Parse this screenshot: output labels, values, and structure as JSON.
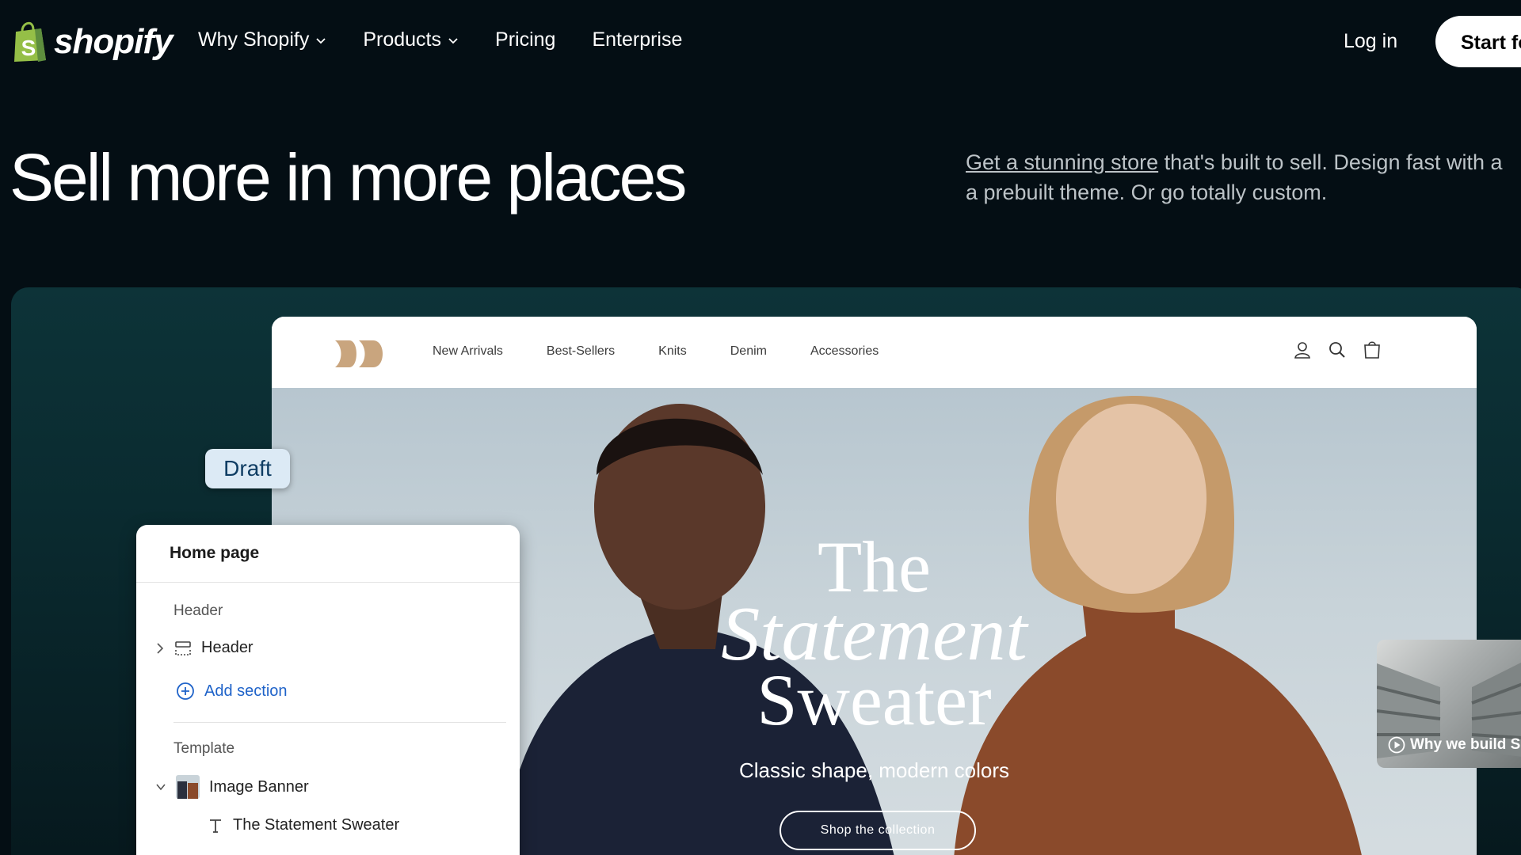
{
  "nav": {
    "logo_text": "shopify",
    "links": [
      "Why Shopify",
      "Products",
      "Pricing",
      "Enterprise"
    ],
    "login": "Log in",
    "cta": "Start fo"
  },
  "hero": {
    "title": "Sell more in more places",
    "link_text": "Get a stunning store",
    "copy_line1_rest": " that's built to sell. Design fast with a",
    "copy_line2": "a prebuilt theme. Or go totally custom."
  },
  "store": {
    "links": [
      "New Arrivals",
      "Best-Sellers",
      "Knits",
      "Denim",
      "Accessories"
    ],
    "icons": [
      "account-icon",
      "search-icon",
      "cart-icon"
    ],
    "banner": {
      "title_line1": "The",
      "title_line2": "Statement",
      "title_line3": "Sweater",
      "subtitle": "Classic shape, modern colors",
      "button": "Shop the collection"
    }
  },
  "badge": "Draft",
  "editor": {
    "title": "Home page",
    "group_header": "Header",
    "header_item": "Header",
    "add_section": "Add section",
    "group_template": "Template",
    "image_banner": "Image Banner",
    "sub_item": "The Statement Sweater"
  },
  "video": {
    "label": "Why we build S"
  },
  "colors": {
    "page_bg": "#040e14",
    "panel_teal": "#0d3338",
    "brand_green": "#95bf47",
    "link_blue": "#1f63c9",
    "store_logo": "#c9a57e",
    "draft_bg": "#dceaf5"
  }
}
